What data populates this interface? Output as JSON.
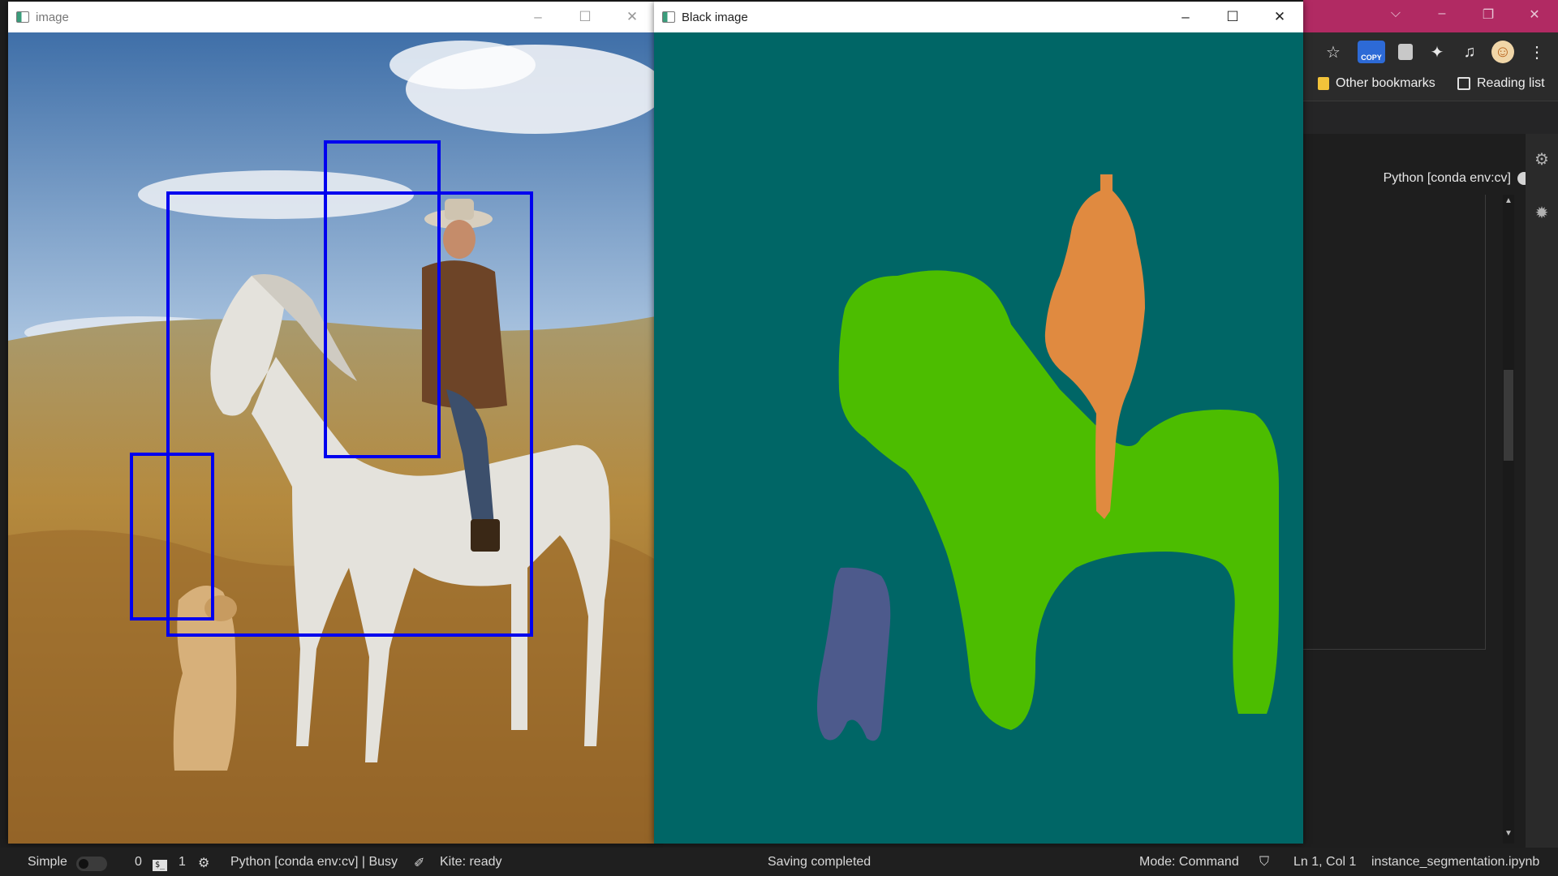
{
  "browser": {
    "window_controls": {
      "tab_search": "⌵",
      "minimize": "–",
      "restore": "❐",
      "close": "✕"
    },
    "toolbar_icons": {
      "copy_badge": "COPY",
      "bookmark": "star-icon",
      "extensions": "puzzle-icon",
      "media": "playlist-icon",
      "menu": "⋮"
    },
    "bookmarks": {
      "other": "Other bookmarks",
      "reading_list": "Reading list"
    }
  },
  "jupyter": {
    "kernel_label": "Python [conda env:cv]"
  },
  "windows": {
    "image": {
      "title": "image"
    },
    "black": {
      "title": "Black image"
    }
  },
  "controls": {
    "minimize": "–",
    "maximize": "☐",
    "close": "✕"
  },
  "status": {
    "mode_toggle_label": "Simple",
    "count_a": "0",
    "count_b": "1",
    "kernel_status": "Python [conda env:cv] | Busy",
    "kite": "Kite: ready",
    "save_state": "Saving completed",
    "mode": "Mode: Command",
    "cursor": "Ln 1, Col 1",
    "filename": "instance_segmentation.ipynb"
  },
  "colors": {
    "browser_accent": "#b12a63",
    "detection_box": "#0000ee",
    "mask_background": "#006666",
    "mask_horse": "#4cbd00",
    "mask_person": "#e08a40",
    "mask_dog": "#4d5a8c"
  }
}
